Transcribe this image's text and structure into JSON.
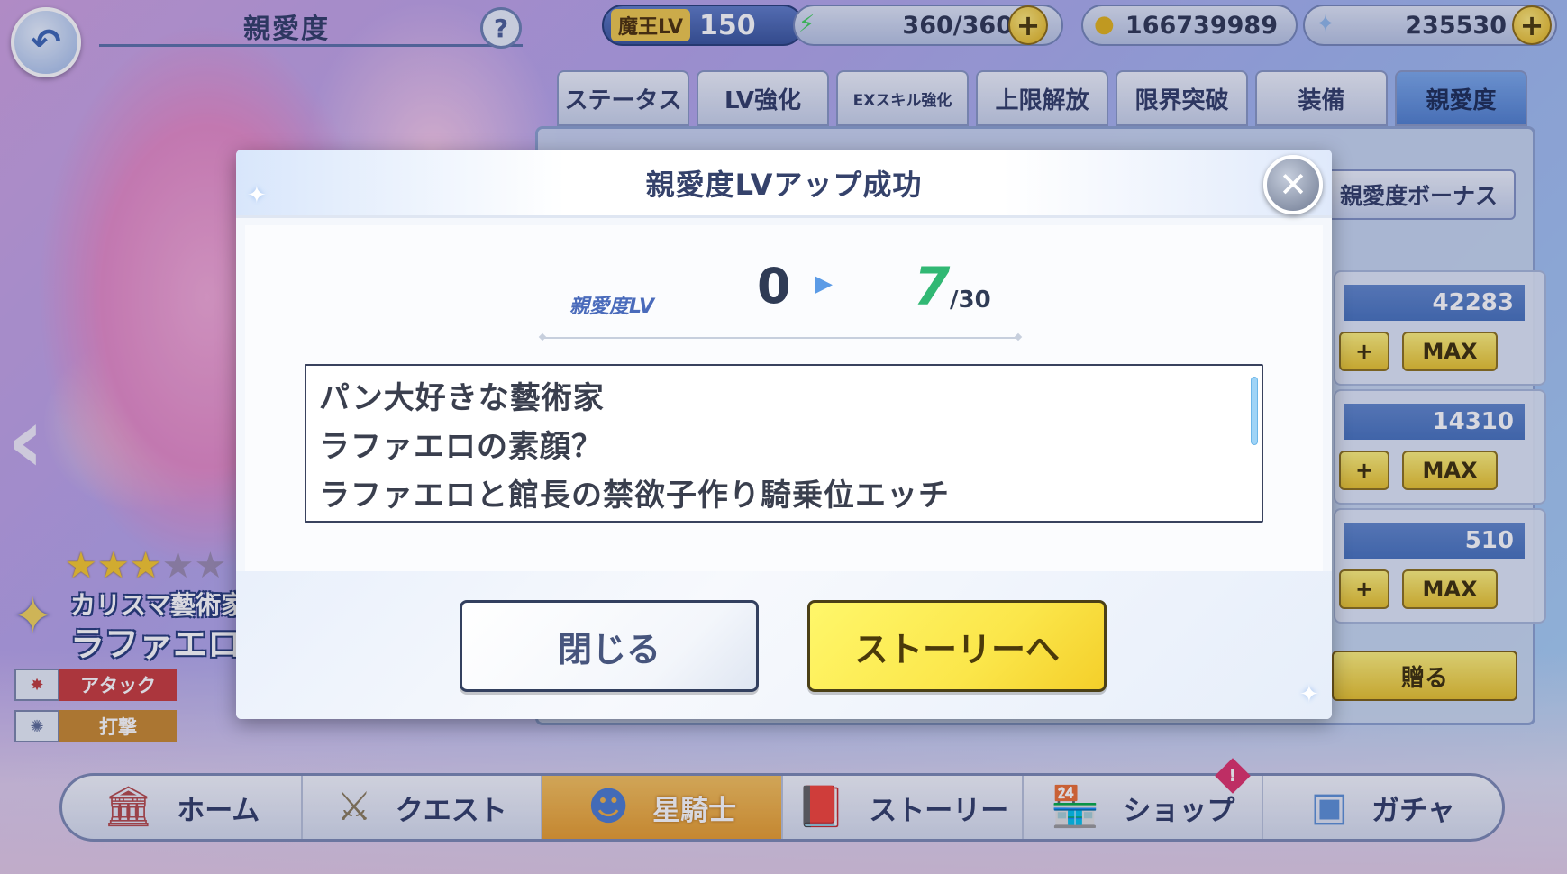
{
  "header": {
    "title": "親愛度",
    "help": "?",
    "player_level_label": "魔王LV",
    "player_level": "150",
    "stamina": "360/360",
    "gold": "166739989",
    "gems": "235530"
  },
  "tabs": [
    {
      "label": "ステータス"
    },
    {
      "label": "LV強化"
    },
    {
      "label": "EXスキル強化"
    },
    {
      "label": "上限解放"
    },
    {
      "label": "限界突破"
    },
    {
      "label": "装備"
    },
    {
      "label": "親愛度"
    }
  ],
  "panel": {
    "bonus_button": "親愛度ボーナス",
    "gifts": [
      {
        "count": "42283",
        "plus": "+",
        "max": "MAX"
      },
      {
        "count": "14310",
        "plus": "+",
        "max": "MAX"
      },
      {
        "count": "510",
        "plus": "+",
        "max": "MAX"
      }
    ],
    "send_button": "贈る"
  },
  "character": {
    "rarity": 3,
    "rarity_max": 5,
    "title": "カリスマ藝術家",
    "name": "ラファエロ",
    "type_label": "アタック",
    "attack_label": "打撃"
  },
  "modal": {
    "title": "親愛度LVアップ成功",
    "lv_caption": "親愛度LV",
    "lv_from": "0",
    "lv_to": "7",
    "lv_max": "/30",
    "story_lines": [
      "パン大好きな藝術家",
      "ラファエロの素顔？",
      "ラファエロと館長の禁欲子作り騎乗位エッチ"
    ],
    "close_button": "閉じる",
    "story_button": "ストーリーへ"
  },
  "nav": [
    {
      "label": "ホーム",
      "icon": "home-icon"
    },
    {
      "label": "クエスト",
      "icon": "quest-icon"
    },
    {
      "label": "星騎士",
      "icon": "knight-icon"
    },
    {
      "label": "ストーリー",
      "icon": "book-icon"
    },
    {
      "label": "ショップ",
      "icon": "shop-icon"
    },
    {
      "label": "ガチャ",
      "icon": "gacha-icon"
    }
  ],
  "colors": {
    "accent_blue": "#4f7fcd",
    "accent_yellow": "#fbe64a",
    "lv_green": "#31b874"
  }
}
